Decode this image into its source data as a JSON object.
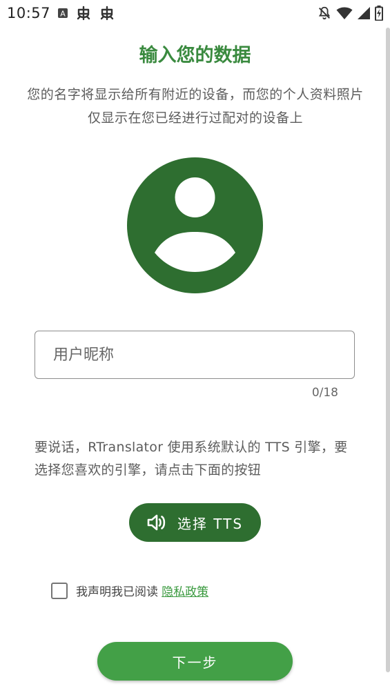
{
  "status_bar": {
    "time": "10:57",
    "icons": [
      "font-a-icon",
      "bug-icon",
      "bug-icon",
      "notifications-off-icon",
      "wifi-icon",
      "signal-icon",
      "battery-charging-icon"
    ]
  },
  "main": {
    "title": "输入您的数据",
    "description": "您的名字将显示给所有附近的设备，而您的个人资料照片仅显示在您已经进行过配对的设备上",
    "avatar_icon": "account-circle-icon",
    "nickname": {
      "value": "",
      "placeholder": "用户昵称",
      "counter": "0/18"
    },
    "tts_info": "要说话，RTranslator 使用系统默认的 TTS 引擎，要选择您喜欢的引擎，请点击下面的按钮",
    "tts_button": {
      "label": "选择 TTS",
      "icon": "volume-up-icon"
    },
    "privacy": {
      "checked": false,
      "text": "我声明我已阅读",
      "link": "隐私政策"
    },
    "next_button": "下一步"
  },
  "colors": {
    "title": "#3a8a3f",
    "avatar": "#2e6e30",
    "tts_button": "#2e6e30",
    "next_button": "#43a047",
    "link": "#3a9a3f"
  }
}
